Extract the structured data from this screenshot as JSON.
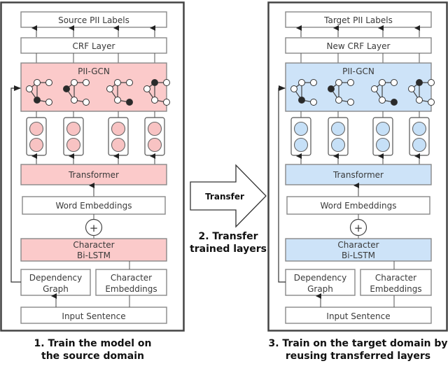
{
  "colors": {
    "source_fill": "#fbcaca",
    "target_fill": "#cde3f8",
    "source_node": "#f8c3c3",
    "target_node": "#c6e0f7",
    "border": "#888888",
    "panel_border": "#444444"
  },
  "panels": [
    {
      "id": "source",
      "labels_top": "Source PII Labels",
      "crf": "CRF Layer",
      "gcn": "PII-GCN",
      "transformer": "Transformer",
      "word_embeddings": "Word Embeddings",
      "plus": "+",
      "char_bilstm_line1": "Character",
      "char_bilstm_line2": "Bi-LSTM",
      "dependency_line1": "Dependency",
      "dependency_line2": "Graph",
      "char_emb_line1": "Character",
      "char_emb_line2": "Embeddings",
      "input": "Input Sentence",
      "caption_line1": "1. Train the model on",
      "caption_line2": "the source domain"
    },
    {
      "id": "target",
      "labels_top": "Target PII Labels",
      "crf": "New CRF Layer",
      "gcn": "PII-GCN",
      "transformer": "Transformer",
      "word_embeddings": "Word Embeddings",
      "plus": "+",
      "char_bilstm_line1": "Character",
      "char_bilstm_line2": "Bi-LSTM",
      "dependency_line1": "Dependency",
      "dependency_line2": "Graph",
      "char_emb_line1": "Character",
      "char_emb_line2": "Embeddings",
      "input": "Input Sentence",
      "caption_line1": "3. Train on the target domain by",
      "caption_line2": "reusing transferred layers"
    }
  ],
  "transfer": {
    "arrow_label": "Transfer",
    "caption_line1": "2. Transfer",
    "caption_line2": "trained layers"
  },
  "gcn_graphs": {
    "dark_node_per_graph": [
      "bottom-mid",
      "left",
      "bottom-right",
      "top-mid"
    ]
  }
}
